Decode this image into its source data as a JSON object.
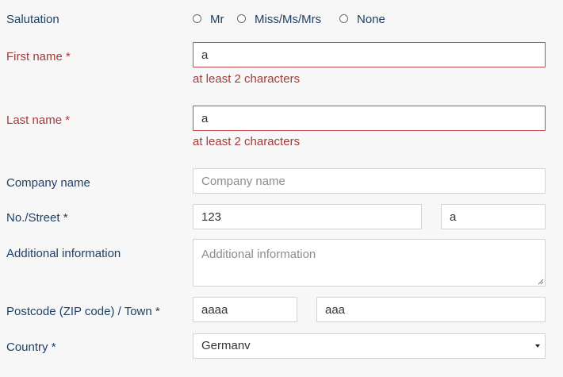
{
  "salutation": {
    "label": "Salutation",
    "options": [
      "Mr",
      "Miss/Ms/Mrs",
      "None"
    ]
  },
  "first_name": {
    "label": "First name *",
    "value": "a",
    "error": "at least 2 characters"
  },
  "last_name": {
    "label": "Last name *",
    "value": "a",
    "error": "at least 2 characters"
  },
  "company": {
    "label": "Company name",
    "placeholder": "Company name"
  },
  "street": {
    "label": "No./Street *",
    "number_value": "123",
    "street_value": "a"
  },
  "additional": {
    "label": "Additional information",
    "placeholder": "Additional information"
  },
  "postcode_town": {
    "label": "Postcode (ZIP code) / Town *",
    "postcode_value": "aaaa",
    "town_value": "aaa"
  },
  "country": {
    "label": "Country *",
    "value": "Germanv"
  },
  "colors": {
    "label": "#1f3f64",
    "error": "#a53a3a",
    "error_border": "#c4484c",
    "border": "#d3d3d3"
  }
}
